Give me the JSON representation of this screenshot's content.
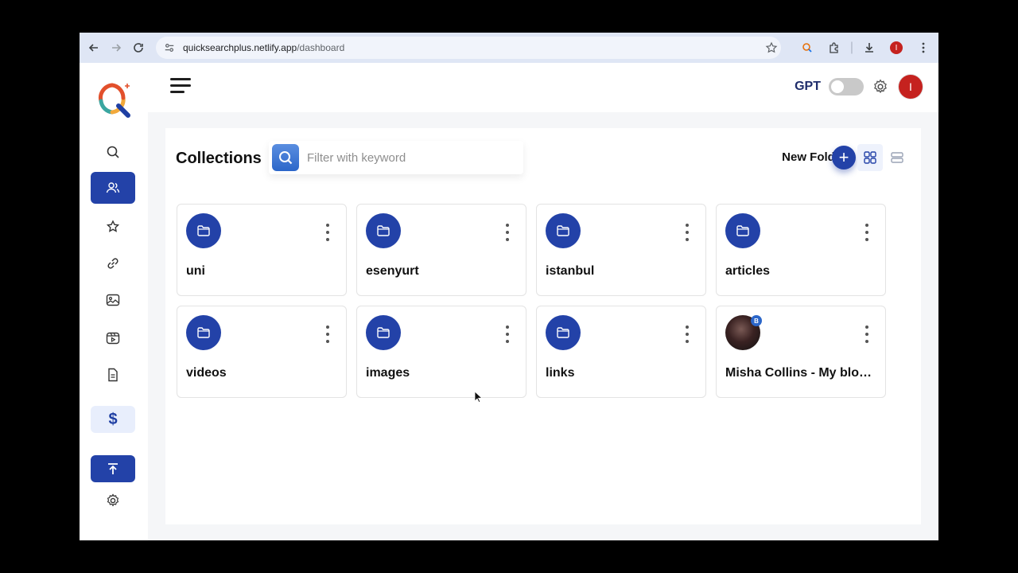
{
  "browser": {
    "url_host": "quicksearchplus.netlify.app",
    "url_path": "/dashboard",
    "profile_initial": "I"
  },
  "header": {
    "gpt_label": "GPT",
    "gpt_enabled": false,
    "avatar_initial": "I"
  },
  "sidebar": {
    "items": [
      {
        "icon": "search-icon",
        "active": false
      },
      {
        "icon": "users-icon",
        "active": true
      },
      {
        "icon": "sparkle-star-icon",
        "active": false
      },
      {
        "icon": "link-icon",
        "active": false
      },
      {
        "icon": "image-icon",
        "active": false
      },
      {
        "icon": "video-icon",
        "active": false
      },
      {
        "icon": "document-icon",
        "active": false
      },
      {
        "icon": "dollar-icon",
        "label": "$",
        "active": false
      },
      {
        "icon": "upload-icon",
        "active": false
      },
      {
        "icon": "gear-icon",
        "active": false
      }
    ]
  },
  "collections": {
    "title": "Collections",
    "search_placeholder": "Filter with keyword",
    "new_folder_label": "New Folder",
    "view_mode": "grid",
    "folders": [
      {
        "name": "uni",
        "type": "folder"
      },
      {
        "name": "esenyurt",
        "type": "folder"
      },
      {
        "name": "istanbul",
        "type": "folder"
      },
      {
        "name": "articles",
        "type": "folder"
      },
      {
        "name": "videos",
        "type": "folder"
      },
      {
        "name": "images",
        "type": "folder"
      },
      {
        "name": "links",
        "type": "folder"
      },
      {
        "name": "Misha Collins - My bloo...",
        "type": "video",
        "badge": "B"
      }
    ]
  },
  "colors": {
    "accent": "#2342a8",
    "avatar": "#c5221f"
  }
}
